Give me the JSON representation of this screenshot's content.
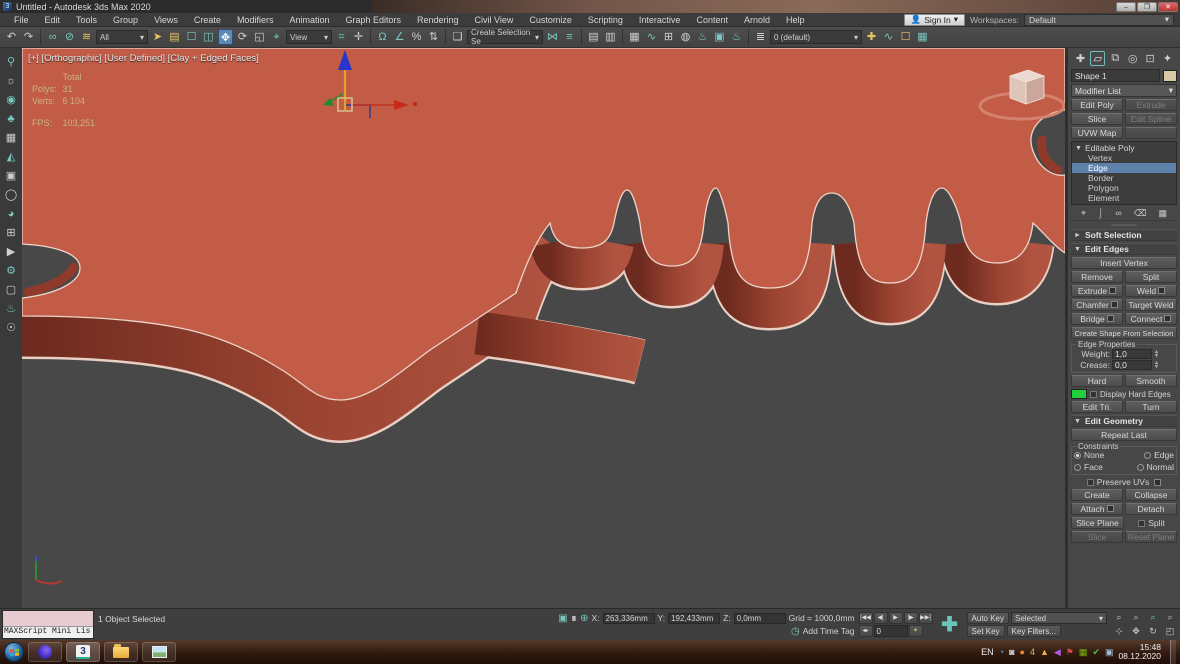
{
  "window": {
    "title": "Untitled - Autodesk 3ds Max 2020",
    "app_icon": "3",
    "minimize": "–",
    "maximize": "❐",
    "close": "✕"
  },
  "menu": {
    "items": [
      "File",
      "Edit",
      "Tools",
      "Group",
      "Views",
      "Create",
      "Modifiers",
      "Animation",
      "Graph Editors",
      "Rendering",
      "Civil View",
      "Customize",
      "Scripting",
      "Interactive",
      "Content",
      "Arnold",
      "Help"
    ]
  },
  "account": {
    "sign_in": "Sign In",
    "person_icon": "👤",
    "workspaces_label": "Workspaces:",
    "workspace_value": "Default",
    "caret": "▾"
  },
  "toolbar": {
    "filter_value": "All",
    "refcoord_value": "View",
    "selection_set_value": "Create Selection Se",
    "layer_value": "0 (default)",
    "caret": "▾",
    "icons": [
      "↶",
      "↷",
      "∞",
      "⊘",
      "≋",
      "➤",
      "▤",
      "☐",
      "◫",
      "✥",
      "⟳",
      "◱",
      "⌖",
      "⌗",
      "✛",
      "Ω",
      "∠",
      "%",
      "⇅",
      "❏",
      "⋈",
      "≡",
      "▤",
      "▥",
      "▦",
      "∿",
      "⊞",
      "◍",
      "♨",
      "▣",
      "♨",
      "✚",
      "≣"
    ]
  },
  "viewport": {
    "label": "[+] [Orthographic] [User Defined] [Clay + Edged Faces]",
    "stats": {
      "total_label": "Total",
      "polys_label": "Polys:",
      "polys_value": "31",
      "verts_label": "Verts:",
      "verts_value": "6 104",
      "fps_label": "FPS:",
      "fps_value": "103,251"
    },
    "left_icons": [
      "⚲",
      "☼",
      "◉",
      "♣",
      "▦",
      "◭",
      "▣",
      "◯",
      "◕",
      "⊞",
      "▶",
      "⚙",
      "▢",
      "♨",
      "☉"
    ]
  },
  "panel": {
    "tabs": [
      "✚",
      "▱",
      "⧉",
      "◎",
      "⊡",
      "✦"
    ],
    "object_name": "Shape 1",
    "modifier_list_label": "Modifier List",
    "caret": "▾",
    "buttons": {
      "edit_poly": "Edit Poly",
      "extrude": "Extrude",
      "slice": "Slice",
      "edit_spline": "Edit Spline",
      "uvw_map": "UVW Map"
    },
    "stack": {
      "root": "Editable Poly",
      "items": [
        "Vertex",
        "Edge",
        "Border",
        "Polygon",
        "Element"
      ]
    },
    "stack_tools": [
      "⌖",
      "⌡",
      "∞",
      "⌫",
      "▦"
    ],
    "soft_selection_title": "Soft Selection",
    "edit_edges": {
      "title": "Edit Edges",
      "insert_vertex": "Insert Vertex",
      "remove": "Remove",
      "split": "Split",
      "extrude": "Extrude",
      "weld": "Weld",
      "chamfer": "Chamfer",
      "target_weld": "Target Weld",
      "bridge": "Bridge",
      "connect": "Connect",
      "create_shape": "Create Shape From Selection",
      "edge_properties": "Edge Properties",
      "weight_label": "Weight:",
      "weight_value": "1,0",
      "crease_label": "Crease:",
      "crease_value": "0,0",
      "hard": "Hard",
      "smooth": "Smooth",
      "display_hard_edges": "Display Hard Edges",
      "edit_tri": "Edit Tri.",
      "turn": "Turn"
    },
    "edit_geometry": {
      "title": "Edit Geometry",
      "repeat_last": "Repeat Last",
      "constraints": "Constraints",
      "none": "None",
      "edge": "Edge",
      "face": "Face",
      "normal": "Normal",
      "preserve_uvs": "Preserve UVs",
      "create": "Create",
      "collapse": "Collapse",
      "attach": "Attach",
      "detach": "Detach",
      "slice_plane": "Slice Plane",
      "split": "Split",
      "slice": "Slice",
      "reset_plane": "Reset Plane"
    }
  },
  "status": {
    "maxscript": "MAXScript Mini Lis",
    "selection": "1 Object Selected",
    "isolate_icon": "▣",
    "lock_icon": "∎",
    "offset_icon": "⊕",
    "x_label": "X:",
    "x_value": "263,336mm",
    "y_label": "Y:",
    "y_value": "192,433mm",
    "z_label": "Z:",
    "z_value": "0,0mm",
    "grid": "Grid = 1000,0mm",
    "time_tag_icon": "◷",
    "add_time_tag": "Add Time Tag",
    "playback": [
      "|◀◀",
      "◀|",
      "▶",
      "|▶",
      "▶▶|"
    ],
    "frame_value": "0",
    "key_icon": "✦",
    "big_plus": "✚",
    "auto_key": "Auto Key",
    "selected_value": "Selected",
    "set_key": "Set Key",
    "key_filters": "Key Filters...",
    "nav_icons": [
      "⌕",
      "⌕",
      "⌕",
      "⌕",
      "⊹",
      "✥",
      "↻",
      "◰"
    ]
  },
  "taskbar": {
    "language": "EN",
    "tray_icons": [
      "◔",
      "◙",
      "●",
      "4",
      "▲",
      "◀",
      "⚑",
      "▦",
      "✔",
      "▣"
    ],
    "time": "15:48",
    "date": "08.12.2020"
  },
  "colors": {
    "accent_teal": "#73c2ba",
    "selection_blue": "#5d81ab",
    "surface_salmon": "#c25c47",
    "side_red_dark": "#6d2a1e",
    "side_red_light": "#b05441",
    "edge_highlight": "#ecd5ca",
    "viewport_bg": "#484848",
    "hard_edge_green": "#1fcf3f",
    "object_color_swatch": "#d8c8a4"
  }
}
